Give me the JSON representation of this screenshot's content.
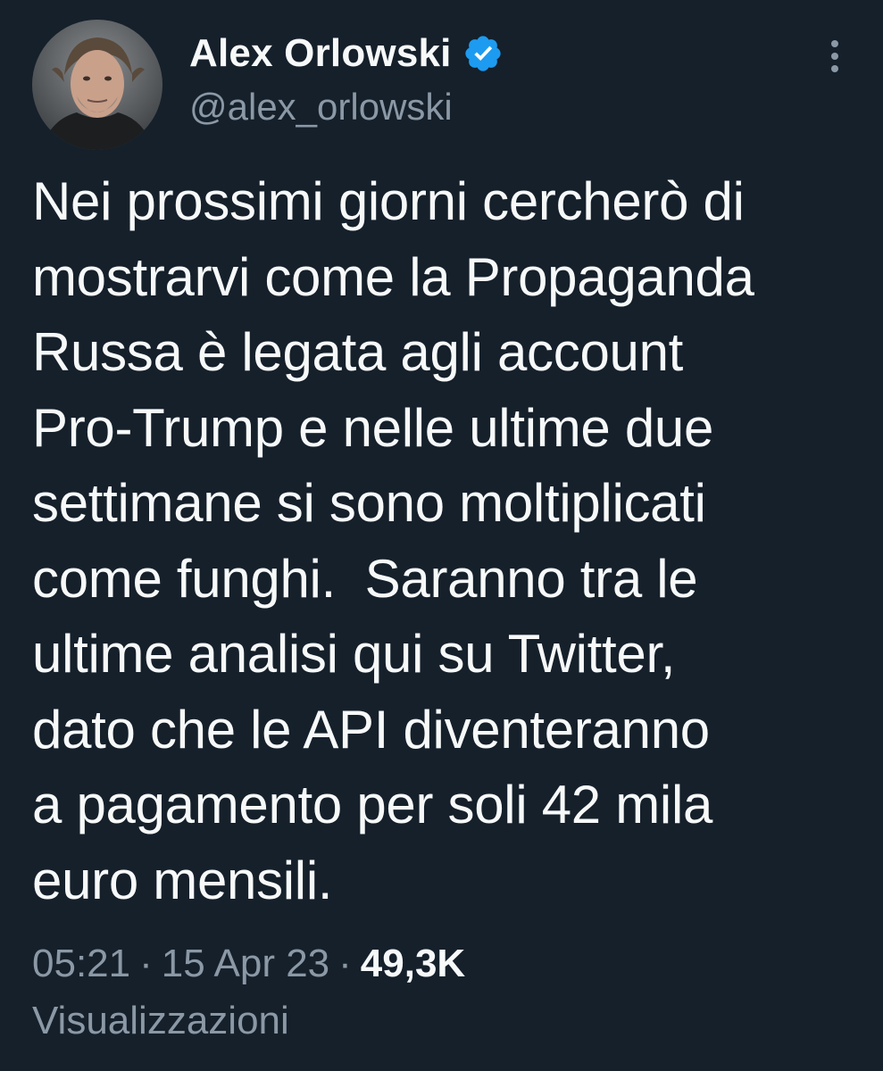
{
  "author": {
    "display_name": "Alex Orlowski",
    "handle": "@alex_orlowski",
    "verified_icon": "verified-badge-icon",
    "avatar_icon": "profile-photo"
  },
  "tweet": {
    "text": "Nei prossimi giorni cercherò di\nmostrarvi come la Propaganda\nRussa è legata agli account\nPro-Trump e nelle ultime due\nsettimane si sono moltiplicati\ncome funghi.  Saranno tra le\nultime analisi qui su Twitter,\ndato che le API diventeranno\na pagamento per soli 42 mila\neuro mensili."
  },
  "meta": {
    "time": "05:21",
    "separator": "·",
    "date": "15 Apr 23",
    "views_count": "49,3K",
    "views_label": "Visualizzazioni"
  },
  "colors": {
    "background": "#15202b",
    "text_primary": "#f7f9f9",
    "text_secondary": "#8b98a5",
    "verified_blue": "#1d9bf0"
  }
}
